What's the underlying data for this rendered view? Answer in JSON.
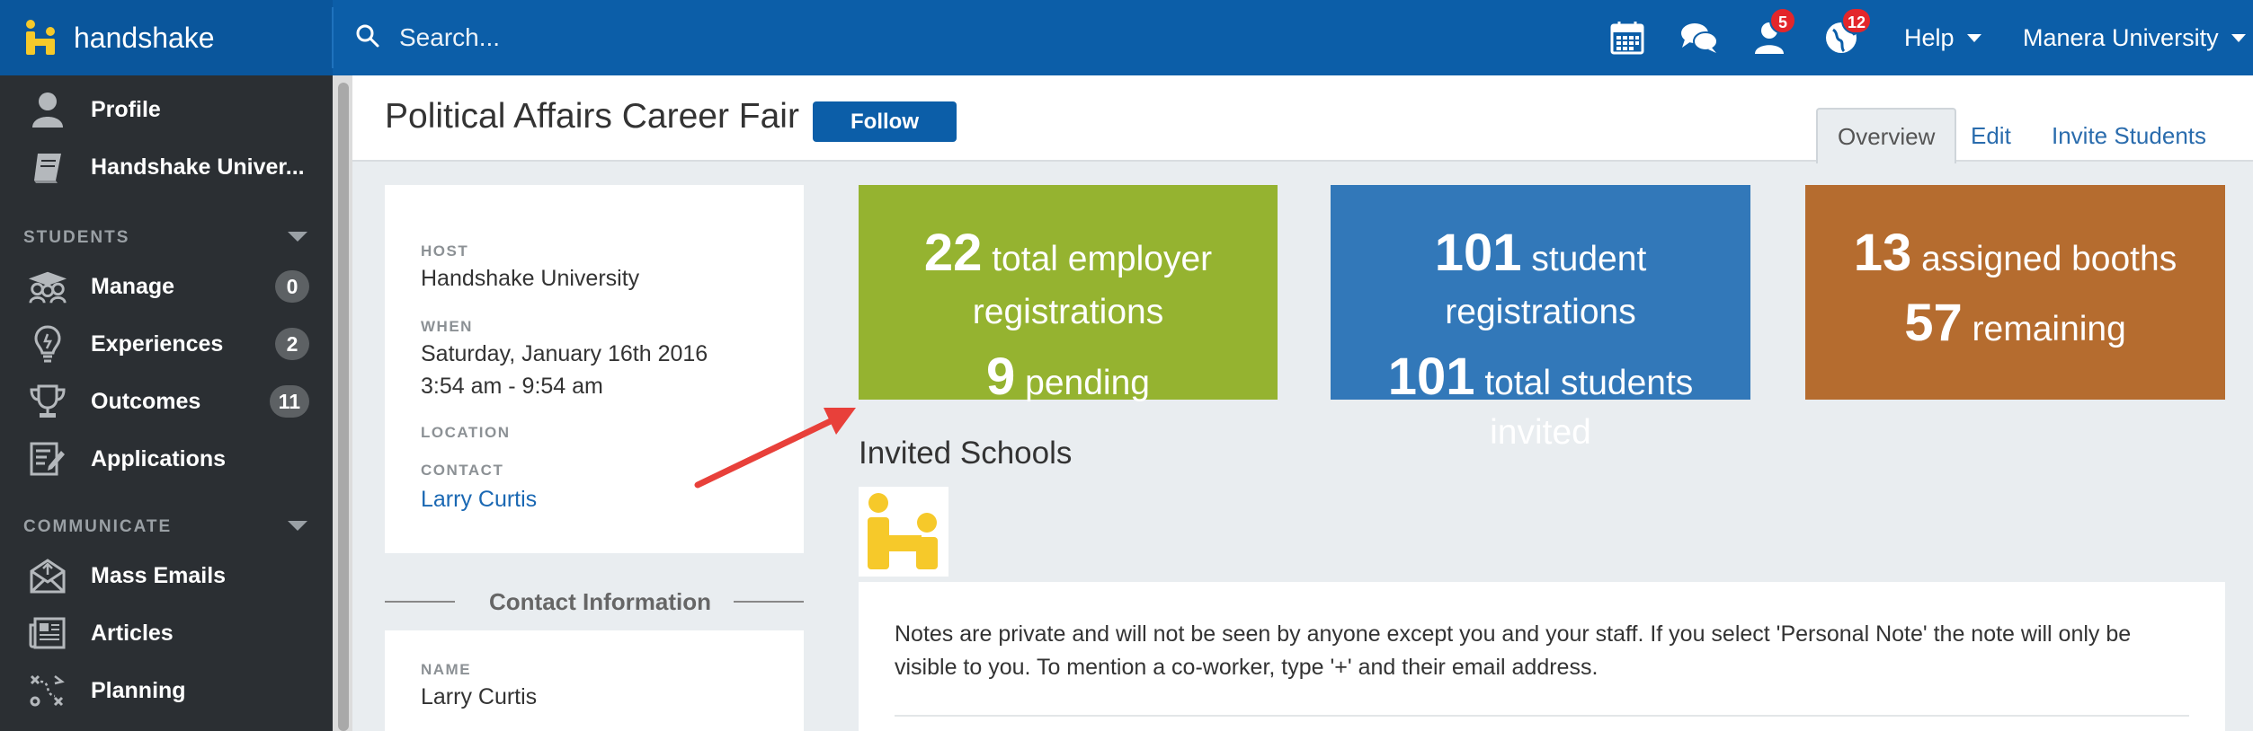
{
  "topbar": {
    "brand": "handshake",
    "search_placeholder": "Search...",
    "notifications_badge": "5",
    "activity_badge": "12",
    "help_label": "Help",
    "university_label": "Manera University"
  },
  "sidebar": {
    "profile_label": "Profile",
    "handshake_u_label": "Handshake Univer...",
    "students_section": "STUDENTS",
    "items": [
      {
        "label": "Manage",
        "count": "0"
      },
      {
        "label": "Experiences",
        "count": "2"
      },
      {
        "label": "Outcomes",
        "count": "11"
      },
      {
        "label": "Applications"
      }
    ],
    "communicate_section": "COMMUNICATE",
    "communicate_items": [
      {
        "label": "Mass Emails"
      },
      {
        "label": "Articles"
      },
      {
        "label": "Planning"
      }
    ]
  },
  "page": {
    "title": "Political Affairs Career Fair",
    "follow_label": "Follow",
    "tabs": [
      "Overview",
      "Edit",
      "Invite Students"
    ]
  },
  "details": {
    "host_label": "HOST",
    "host_value": "Handshake University",
    "when_label": "WHEN",
    "when_date": "Saturday, January 16th 2016",
    "when_time": "3:54 am - 9:54 am",
    "location_label": "LOCATION",
    "contact_label": "CONTACT",
    "contact_value": "Larry Curtis"
  },
  "contact_info": {
    "title": "Contact Information",
    "name_label": "NAME",
    "name_value": "Larry Curtis"
  },
  "stats": {
    "employers": {
      "count": "22",
      "text1": "total employer",
      "text2": "registrations",
      "pending_count": "9",
      "pending_text": "pending"
    },
    "students": {
      "count": "101",
      "text1": "student",
      "text2": "registrations",
      "invited_count": "101",
      "invited_text1": "total students",
      "invited_text2": "invited"
    },
    "booths": {
      "assigned_count": "13",
      "assigned_text": "assigned booths",
      "remaining_count": "57",
      "remaining_text": "remaining"
    }
  },
  "invited": {
    "title": "Invited Schools"
  },
  "notes": {
    "text": "Notes are private and will not be seen by anyone except you and your staff. If you select 'Personal Note' the note will only be visible to you. To mention a co-worker, type '+' and their email address."
  },
  "colors": {
    "topbar": "#0c5ea8",
    "sidebar": "#2b2f33",
    "tile_green": "#95b330",
    "tile_blue": "#3278b9",
    "tile_orange": "#b56c2f",
    "arrow": "#e8403a",
    "logo_yellow": "#f6c92a"
  }
}
